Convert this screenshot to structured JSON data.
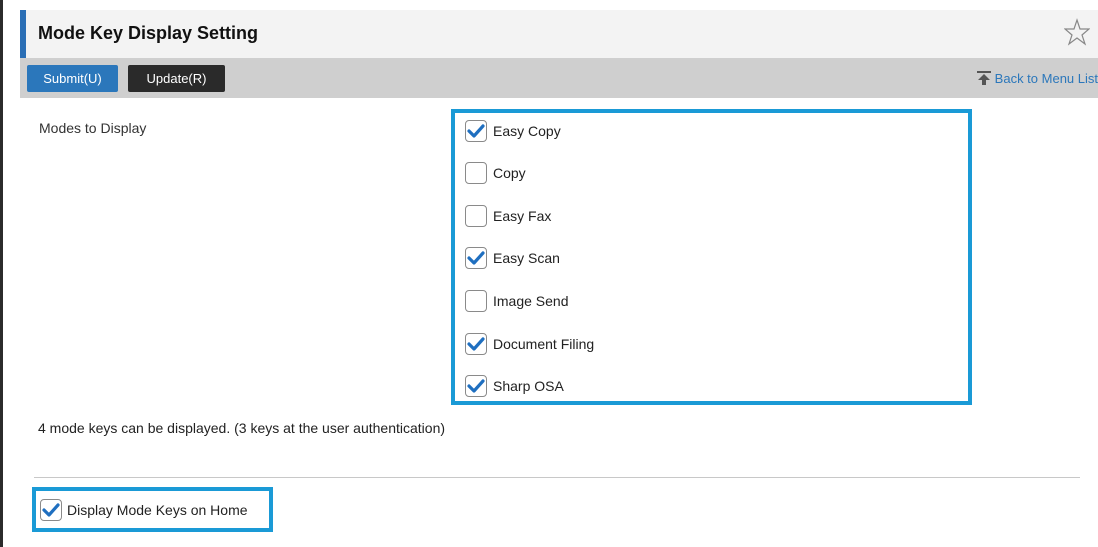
{
  "header": {
    "title": "Mode Key Display Setting"
  },
  "toolbar": {
    "submit_label": "Submit(U)",
    "update_label": "Update(R)",
    "back_label": "Back to Menu List"
  },
  "modes": {
    "label": "Modes to Display",
    "items": [
      {
        "label": "Easy Copy",
        "checked": true
      },
      {
        "label": "Copy",
        "checked": false
      },
      {
        "label": "Easy Fax",
        "checked": false
      },
      {
        "label": "Easy Scan",
        "checked": true
      },
      {
        "label": "Image Send",
        "checked": false
      },
      {
        "label": "Document Filing",
        "checked": true
      },
      {
        "label": "Sharp OSA",
        "checked": true
      }
    ]
  },
  "info_text": "4 mode keys can be displayed. (3 keys at the user authentication)",
  "home": {
    "label": "Display Mode Keys on Home",
    "checked": true
  },
  "colors": {
    "accent": "#2b77bb",
    "highlight": "#1a9ad6",
    "dark_button": "#2a2a2a"
  },
  "icons": {
    "favorite": "star-icon",
    "back": "back-to-top-icon",
    "check": "checkmark-icon"
  }
}
